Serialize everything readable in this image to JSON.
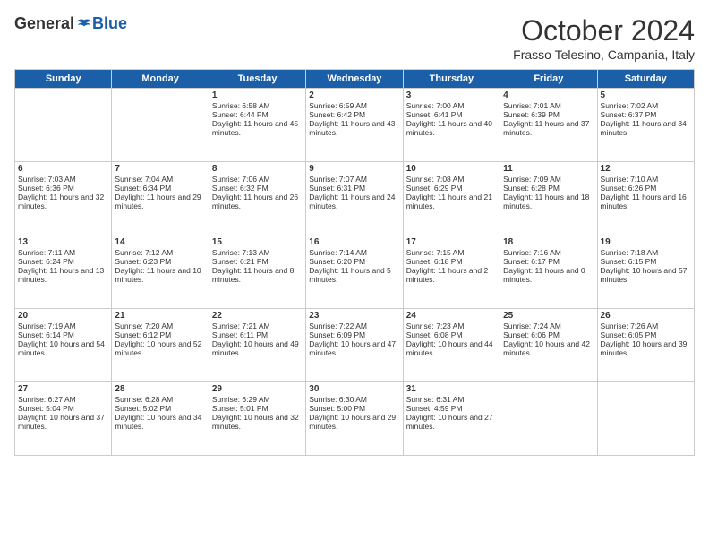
{
  "header": {
    "logo": {
      "general": "General",
      "blue": "Blue"
    },
    "title": "October 2024",
    "location": "Frasso Telesino, Campania, Italy"
  },
  "days_of_week": [
    "Sunday",
    "Monday",
    "Tuesday",
    "Wednesday",
    "Thursday",
    "Friday",
    "Saturday"
  ],
  "weeks": [
    [
      {
        "day": null
      },
      {
        "day": null
      },
      {
        "day": "1",
        "sunrise": "6:58 AM",
        "sunset": "6:44 PM",
        "daylight": "11 hours and 45 minutes."
      },
      {
        "day": "2",
        "sunrise": "6:59 AM",
        "sunset": "6:42 PM",
        "daylight": "11 hours and 43 minutes."
      },
      {
        "day": "3",
        "sunrise": "7:00 AM",
        "sunset": "6:41 PM",
        "daylight": "11 hours and 40 minutes."
      },
      {
        "day": "4",
        "sunrise": "7:01 AM",
        "sunset": "6:39 PM",
        "daylight": "11 hours and 37 minutes."
      },
      {
        "day": "5",
        "sunrise": "7:02 AM",
        "sunset": "6:37 PM",
        "daylight": "11 hours and 34 minutes."
      }
    ],
    [
      {
        "day": "6",
        "sunrise": "7:03 AM",
        "sunset": "6:36 PM",
        "daylight": "11 hours and 32 minutes."
      },
      {
        "day": "7",
        "sunrise": "7:04 AM",
        "sunset": "6:34 PM",
        "daylight": "11 hours and 29 minutes."
      },
      {
        "day": "8",
        "sunrise": "7:06 AM",
        "sunset": "6:32 PM",
        "daylight": "11 hours and 26 minutes."
      },
      {
        "day": "9",
        "sunrise": "7:07 AM",
        "sunset": "6:31 PM",
        "daylight": "11 hours and 24 minutes."
      },
      {
        "day": "10",
        "sunrise": "7:08 AM",
        "sunset": "6:29 PM",
        "daylight": "11 hours and 21 minutes."
      },
      {
        "day": "11",
        "sunrise": "7:09 AM",
        "sunset": "6:28 PM",
        "daylight": "11 hours and 18 minutes."
      },
      {
        "day": "12",
        "sunrise": "7:10 AM",
        "sunset": "6:26 PM",
        "daylight": "11 hours and 16 minutes."
      }
    ],
    [
      {
        "day": "13",
        "sunrise": "7:11 AM",
        "sunset": "6:24 PM",
        "daylight": "11 hours and 13 minutes."
      },
      {
        "day": "14",
        "sunrise": "7:12 AM",
        "sunset": "6:23 PM",
        "daylight": "11 hours and 10 minutes."
      },
      {
        "day": "15",
        "sunrise": "7:13 AM",
        "sunset": "6:21 PM",
        "daylight": "11 hours and 8 minutes."
      },
      {
        "day": "16",
        "sunrise": "7:14 AM",
        "sunset": "6:20 PM",
        "daylight": "11 hours and 5 minutes."
      },
      {
        "day": "17",
        "sunrise": "7:15 AM",
        "sunset": "6:18 PM",
        "daylight": "11 hours and 2 minutes."
      },
      {
        "day": "18",
        "sunrise": "7:16 AM",
        "sunset": "6:17 PM",
        "daylight": "11 hours and 0 minutes."
      },
      {
        "day": "19",
        "sunrise": "7:18 AM",
        "sunset": "6:15 PM",
        "daylight": "10 hours and 57 minutes."
      }
    ],
    [
      {
        "day": "20",
        "sunrise": "7:19 AM",
        "sunset": "6:14 PM",
        "daylight": "10 hours and 54 minutes."
      },
      {
        "day": "21",
        "sunrise": "7:20 AM",
        "sunset": "6:12 PM",
        "daylight": "10 hours and 52 minutes."
      },
      {
        "day": "22",
        "sunrise": "7:21 AM",
        "sunset": "6:11 PM",
        "daylight": "10 hours and 49 minutes."
      },
      {
        "day": "23",
        "sunrise": "7:22 AM",
        "sunset": "6:09 PM",
        "daylight": "10 hours and 47 minutes."
      },
      {
        "day": "24",
        "sunrise": "7:23 AM",
        "sunset": "6:08 PM",
        "daylight": "10 hours and 44 minutes."
      },
      {
        "day": "25",
        "sunrise": "7:24 AM",
        "sunset": "6:06 PM",
        "daylight": "10 hours and 42 minutes."
      },
      {
        "day": "26",
        "sunrise": "7:26 AM",
        "sunset": "6:05 PM",
        "daylight": "10 hours and 39 minutes."
      }
    ],
    [
      {
        "day": "27",
        "sunrise": "6:27 AM",
        "sunset": "5:04 PM",
        "daylight": "10 hours and 37 minutes."
      },
      {
        "day": "28",
        "sunrise": "6:28 AM",
        "sunset": "5:02 PM",
        "daylight": "10 hours and 34 minutes."
      },
      {
        "day": "29",
        "sunrise": "6:29 AM",
        "sunset": "5:01 PM",
        "daylight": "10 hours and 32 minutes."
      },
      {
        "day": "30",
        "sunrise": "6:30 AM",
        "sunset": "5:00 PM",
        "daylight": "10 hours and 29 minutes."
      },
      {
        "day": "31",
        "sunrise": "6:31 AM",
        "sunset": "4:59 PM",
        "daylight": "10 hours and 27 minutes."
      },
      {
        "day": null
      },
      {
        "day": null
      }
    ]
  ]
}
